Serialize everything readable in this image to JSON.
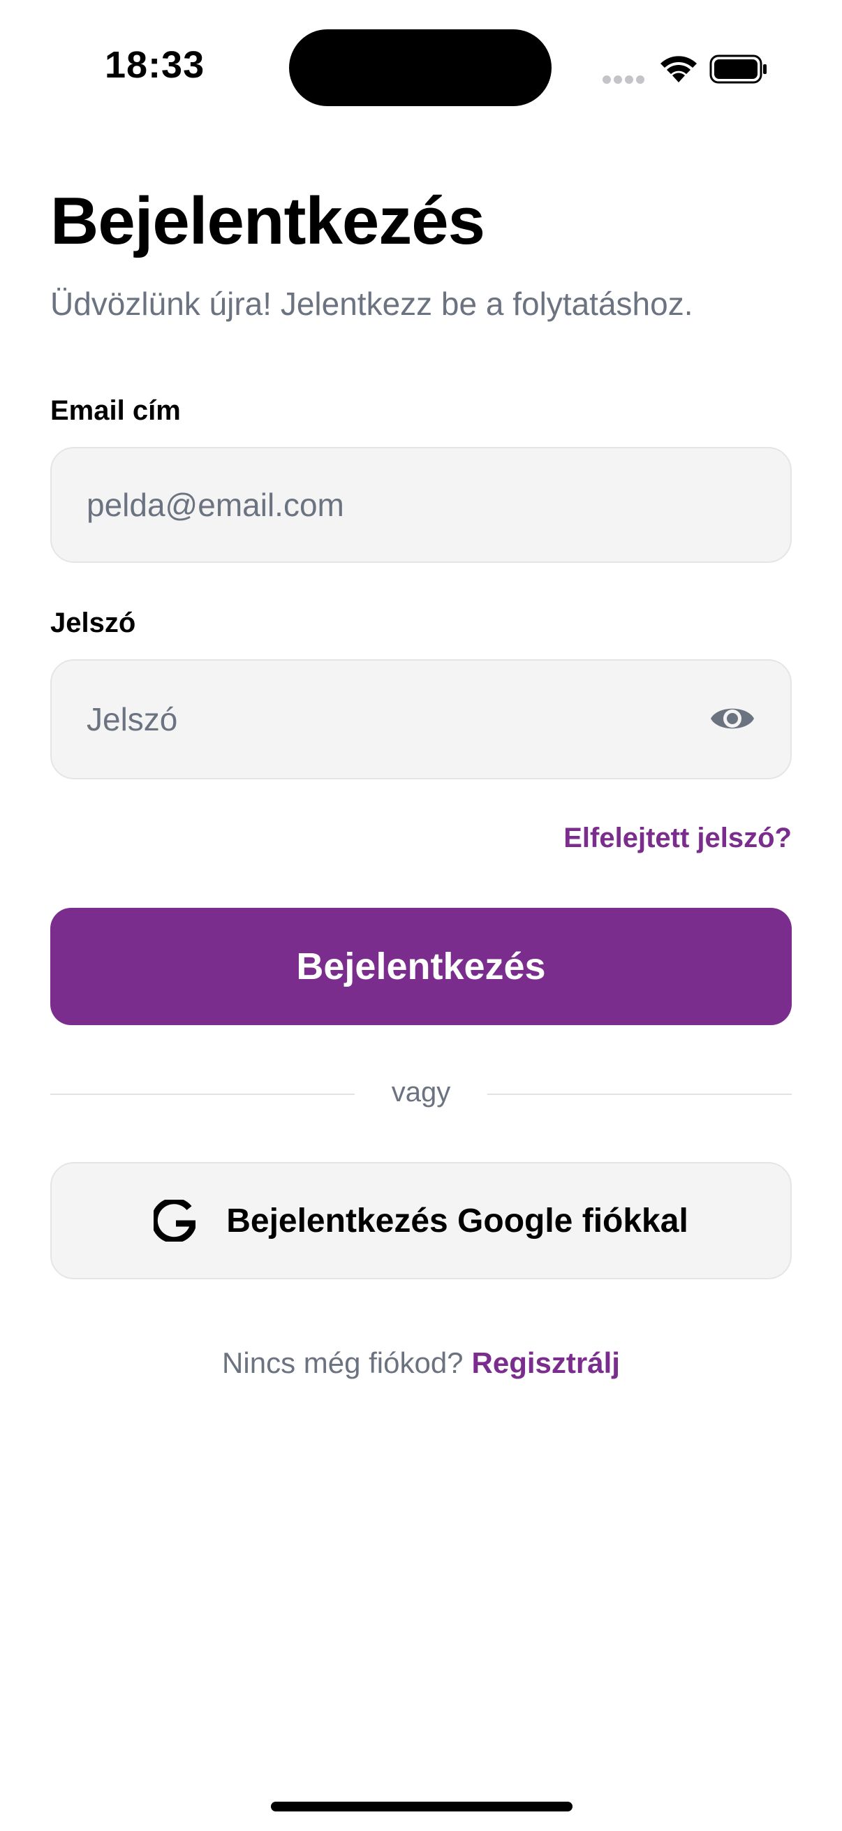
{
  "status_bar": {
    "time": "18:33"
  },
  "header": {
    "title": "Bejelentkezés",
    "subtitle": "Üdvözlünk újra! Jelentkezz be a folytatáshoz."
  },
  "form": {
    "email_label": "Email cím",
    "email_placeholder": "pelda@email.com",
    "email_value": "",
    "password_label": "Jelszó",
    "password_placeholder": "Jelszó",
    "password_value": "",
    "forgot_link": "Elfelejtett jelszó?",
    "submit_label": "Bejelentkezés"
  },
  "divider_text": "vagy",
  "google": {
    "label": "Bejelentkezés Google fiókkal",
    "icon": "google-g-icon"
  },
  "footer": {
    "prompt": "Nincs még fiókod?",
    "register_link": "Regisztrálj"
  },
  "icons": {
    "password_toggle": "eye-icon",
    "status": [
      "signal-icon",
      "wifi-icon",
      "battery-icon"
    ]
  },
  "colors": {
    "accent": "#7b2d8e",
    "muted_text": "#6b7280",
    "input_background": "#f4f4f5"
  }
}
